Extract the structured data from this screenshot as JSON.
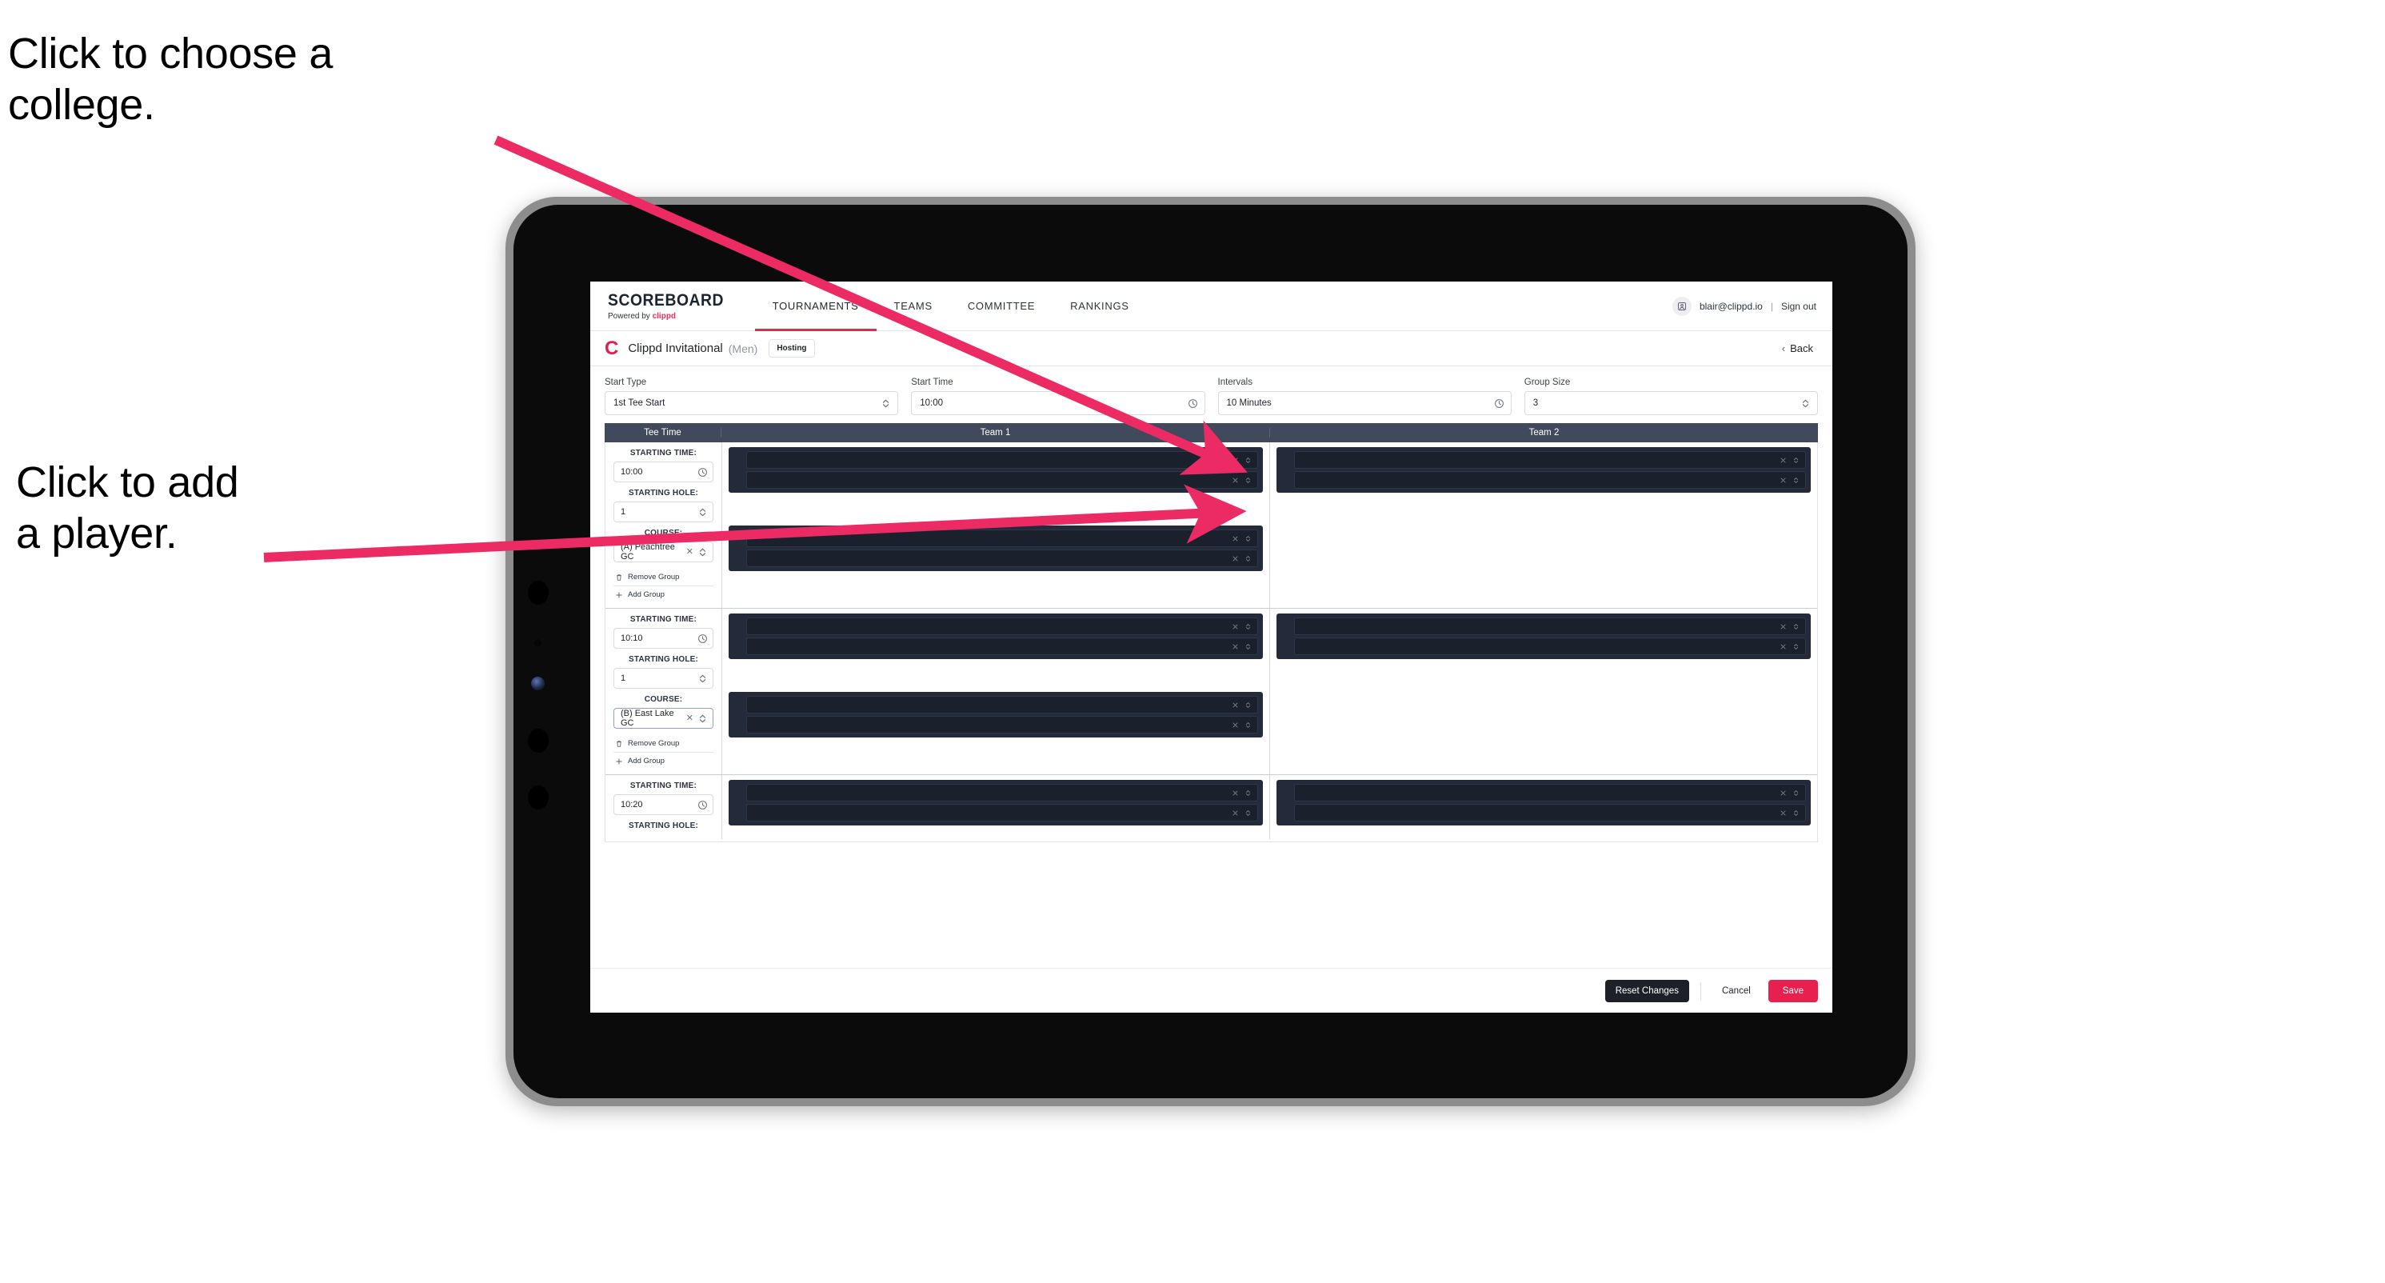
{
  "annotations": [
    {
      "id": "choose-college",
      "text": "Click to choose a\ncollege."
    },
    {
      "id": "add-player",
      "text": "Click to add\na player."
    }
  ],
  "colors": {
    "accent_pink": "#e8204f",
    "brand_red": "#e01f4e",
    "annotation_arrow": "#ec2a63",
    "table_header": "#414a5c",
    "player_block": "#232b3a"
  },
  "nav": {
    "brand_title": "SCOREBOARD",
    "brand_sub_prefix": "Powered by ",
    "brand_sub_accent": "clippd",
    "tabs": [
      {
        "label": "TOURNAMENTS",
        "active": true
      },
      {
        "label": "TEAMS",
        "active": false
      },
      {
        "label": "COMMITTEE",
        "active": false
      },
      {
        "label": "RANKINGS",
        "active": false
      }
    ],
    "user_email": "blair@clippd.io",
    "separator": "|",
    "sign_out": "Sign out",
    "avatar_icon": "user-avatar-icon"
  },
  "tournament": {
    "logo_letter": "C",
    "name": "Clippd Invitational",
    "gender": "(Men)",
    "status_badge": "Hosting",
    "back_label": "Back",
    "back_chevron": "‹"
  },
  "settings": [
    {
      "label": "Start Type",
      "value": "1st Tee Start",
      "icon": "stepper-updown-icon"
    },
    {
      "label": "Start Time",
      "value": "10:00",
      "icon": "clock-icon"
    },
    {
      "label": "Intervals",
      "value": "10 Minutes",
      "icon": "clock-icon"
    },
    {
      "label": "Group Size",
      "value": "3",
      "icon": "stepper-updown-icon"
    }
  ],
  "grid": {
    "headers": [
      "Tee Time",
      "Team 1",
      "Team 2"
    ],
    "field_labels": {
      "time": "STARTING TIME:",
      "hole": "STARTING HOLE:",
      "course": "COURSE:"
    },
    "actions": {
      "remove_group": "Remove Group",
      "add_group": "Add Group",
      "remove_icon": "trash-icon",
      "add_icon": "plus-icon"
    },
    "row_icons": {
      "clear": "close-x-icon",
      "stepper": "stepper-updown-icon",
      "clock": "clock-icon"
    },
    "rows": [
      {
        "starting_time": "10:00",
        "starting_hole": "1",
        "course": "(A) Peachtree GC",
        "course_focused": false,
        "team1": [
          {
            "players": 2,
            "redacted": true
          },
          {
            "players": 2,
            "redacted": true
          }
        ],
        "team2": [
          {
            "players": 2,
            "redacted": true
          }
        ]
      },
      {
        "starting_time": "10:10",
        "starting_hole": "1",
        "course": "(B) East Lake GC",
        "course_focused": true,
        "team1": [
          {
            "players": 2,
            "redacted": true
          },
          {
            "players": 2,
            "redacted": true
          }
        ],
        "team2": [
          {
            "players": 2,
            "redacted": true
          }
        ]
      },
      {
        "starting_time": "10:20",
        "starting_hole": "",
        "course": "",
        "course_focused": false,
        "team1": [
          {
            "players": 2,
            "redacted": true
          }
        ],
        "team2": [
          {
            "players": 2,
            "redacted": true
          }
        ]
      }
    ]
  },
  "footer": {
    "reset_label": "Reset Changes",
    "cancel_label": "Cancel",
    "save_label": "Save"
  }
}
